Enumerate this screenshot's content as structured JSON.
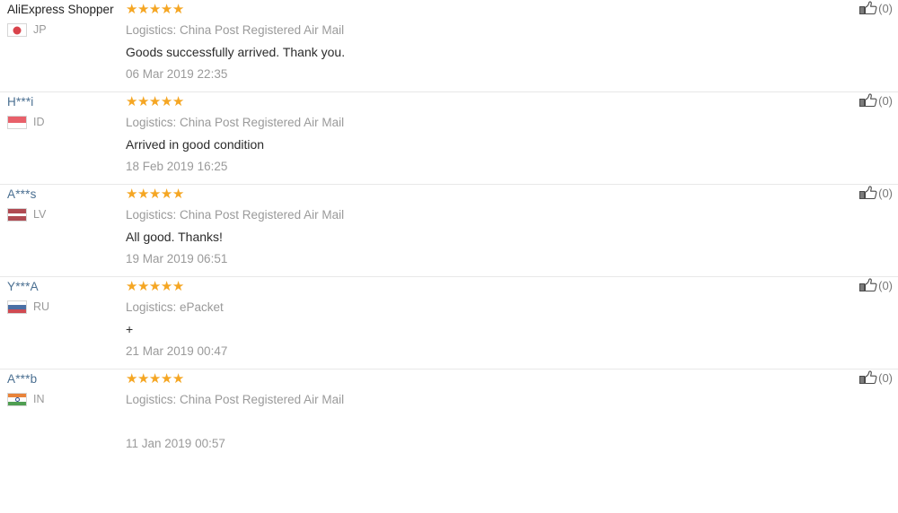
{
  "reviews": [
    {
      "user": "AliExpress Shopper",
      "user_is_anon_buyer": true,
      "country_code": "JP",
      "flag": "jp-flag-icon",
      "rating": 5,
      "logistics": "Logistics: China Post Registered Air Mail",
      "text": "Goods successfully arrived. Thank you.",
      "date": "06 Mar 2019 22:35",
      "helpful_count": "(0)"
    },
    {
      "user": "H***i",
      "user_is_anon_buyer": false,
      "country_code": "ID",
      "flag": "id-flag-icon",
      "rating": 5,
      "logistics": "Logistics: China Post Registered Air Mail",
      "text": "Arrived in good condition",
      "date": "18 Feb 2019 16:25",
      "helpful_count": "(0)"
    },
    {
      "user": "A***s",
      "user_is_anon_buyer": false,
      "country_code": "LV",
      "flag": "lv-flag-icon",
      "rating": 5,
      "logistics": "Logistics: China Post Registered Air Mail",
      "text": "All good. Thanks!",
      "date": "19 Mar 2019 06:51",
      "helpful_count": "(0)"
    },
    {
      "user": "Y***A",
      "user_is_anon_buyer": false,
      "country_code": "RU",
      "flag": "ru-flag-icon",
      "rating": 5,
      "logistics": "Logistics: ePacket",
      "text": "+",
      "date": "21 Mar 2019 00:47",
      "helpful_count": "(0)"
    },
    {
      "user": "A***b",
      "user_is_anon_buyer": false,
      "country_code": "IN",
      "flag": "in-flag-icon",
      "rating": 5,
      "logistics": "Logistics: China Post Registered Air Mail",
      "text": "",
      "date": "11 Jan 2019 00:57",
      "helpful_count": "(0)"
    }
  ],
  "icons": {
    "star": "★",
    "thumb_up": "thumb-up-icon"
  },
  "colors": {
    "star_filled": "#f5a623",
    "username_link": "#4a6f91",
    "muted_text": "#9a9a9a",
    "body_text": "#2b2b2b",
    "divider": "#e8e8e8"
  }
}
